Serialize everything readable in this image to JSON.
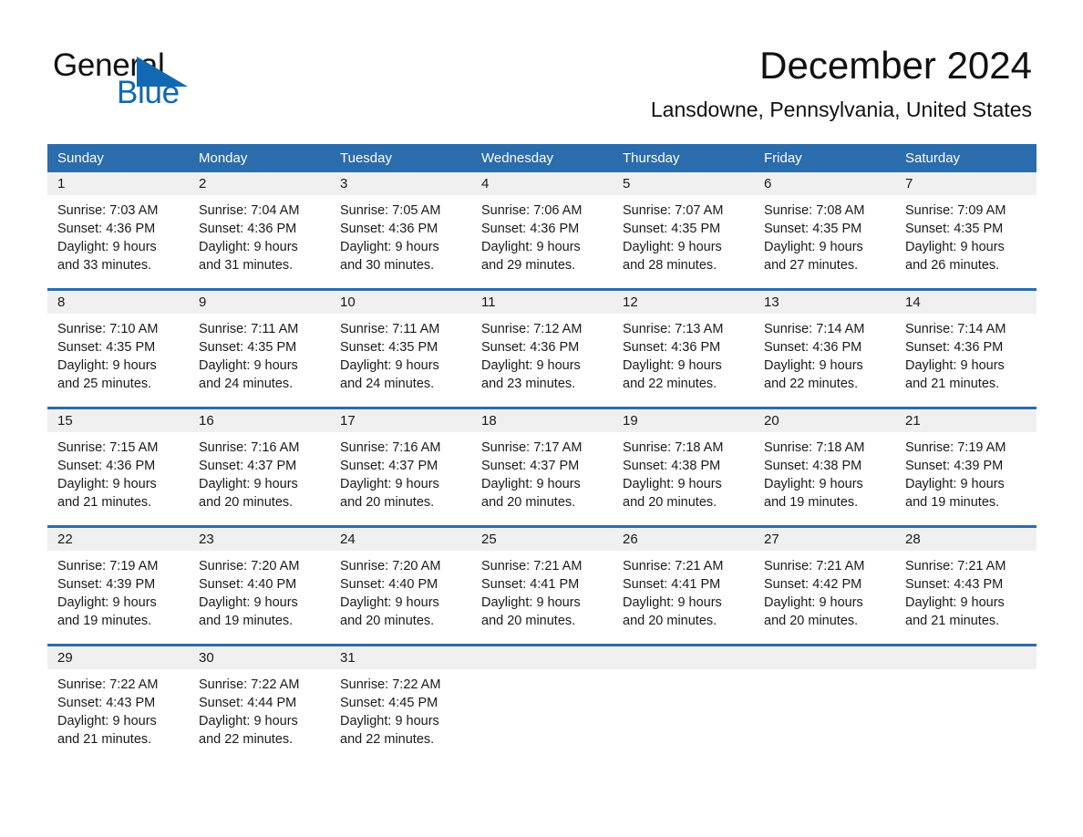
{
  "logo": {
    "word_one": "General",
    "word_two": "Blue",
    "triangle_icon": "blue-triangle-icon",
    "blue": "#1268b3"
  },
  "header": {
    "title": "December 2024",
    "location": "Lansdowne, Pennsylvania, United States"
  },
  "colors": {
    "header_blue": "#2b6cac",
    "row_divider_blue": "#2b6cac",
    "daynum_band": "#f0f0f0",
    "text": "#1a1a1a"
  },
  "weekdays": [
    "Sunday",
    "Monday",
    "Tuesday",
    "Wednesday",
    "Thursday",
    "Friday",
    "Saturday"
  ],
  "weeks": [
    [
      {
        "day": "1",
        "sunrise": "Sunrise: 7:03 AM",
        "sunset": "Sunset: 4:36 PM",
        "daylight_1": "Daylight: 9 hours",
        "daylight_2": "and 33 minutes."
      },
      {
        "day": "2",
        "sunrise": "Sunrise: 7:04 AM",
        "sunset": "Sunset: 4:36 PM",
        "daylight_1": "Daylight: 9 hours",
        "daylight_2": "and 31 minutes."
      },
      {
        "day": "3",
        "sunrise": "Sunrise: 7:05 AM",
        "sunset": "Sunset: 4:36 PM",
        "daylight_1": "Daylight: 9 hours",
        "daylight_2": "and 30 minutes."
      },
      {
        "day": "4",
        "sunrise": "Sunrise: 7:06 AM",
        "sunset": "Sunset: 4:36 PM",
        "daylight_1": "Daylight: 9 hours",
        "daylight_2": "and 29 minutes."
      },
      {
        "day": "5",
        "sunrise": "Sunrise: 7:07 AM",
        "sunset": "Sunset: 4:35 PM",
        "daylight_1": "Daylight: 9 hours",
        "daylight_2": "and 28 minutes."
      },
      {
        "day": "6",
        "sunrise": "Sunrise: 7:08 AM",
        "sunset": "Sunset: 4:35 PM",
        "daylight_1": "Daylight: 9 hours",
        "daylight_2": "and 27 minutes."
      },
      {
        "day": "7",
        "sunrise": "Sunrise: 7:09 AM",
        "sunset": "Sunset: 4:35 PM",
        "daylight_1": "Daylight: 9 hours",
        "daylight_2": "and 26 minutes."
      }
    ],
    [
      {
        "day": "8",
        "sunrise": "Sunrise: 7:10 AM",
        "sunset": "Sunset: 4:35 PM",
        "daylight_1": "Daylight: 9 hours",
        "daylight_2": "and 25 minutes."
      },
      {
        "day": "9",
        "sunrise": "Sunrise: 7:11 AM",
        "sunset": "Sunset: 4:35 PM",
        "daylight_1": "Daylight: 9 hours",
        "daylight_2": "and 24 minutes."
      },
      {
        "day": "10",
        "sunrise": "Sunrise: 7:11 AM",
        "sunset": "Sunset: 4:35 PM",
        "daylight_1": "Daylight: 9 hours",
        "daylight_2": "and 24 minutes."
      },
      {
        "day": "11",
        "sunrise": "Sunrise: 7:12 AM",
        "sunset": "Sunset: 4:36 PM",
        "daylight_1": "Daylight: 9 hours",
        "daylight_2": "and 23 minutes."
      },
      {
        "day": "12",
        "sunrise": "Sunrise: 7:13 AM",
        "sunset": "Sunset: 4:36 PM",
        "daylight_1": "Daylight: 9 hours",
        "daylight_2": "and 22 minutes."
      },
      {
        "day": "13",
        "sunrise": "Sunrise: 7:14 AM",
        "sunset": "Sunset: 4:36 PM",
        "daylight_1": "Daylight: 9 hours",
        "daylight_2": "and 22 minutes."
      },
      {
        "day": "14",
        "sunrise": "Sunrise: 7:14 AM",
        "sunset": "Sunset: 4:36 PM",
        "daylight_1": "Daylight: 9 hours",
        "daylight_2": "and 21 minutes."
      }
    ],
    [
      {
        "day": "15",
        "sunrise": "Sunrise: 7:15 AM",
        "sunset": "Sunset: 4:36 PM",
        "daylight_1": "Daylight: 9 hours",
        "daylight_2": "and 21 minutes."
      },
      {
        "day": "16",
        "sunrise": "Sunrise: 7:16 AM",
        "sunset": "Sunset: 4:37 PM",
        "daylight_1": "Daylight: 9 hours",
        "daylight_2": "and 20 minutes."
      },
      {
        "day": "17",
        "sunrise": "Sunrise: 7:16 AM",
        "sunset": "Sunset: 4:37 PM",
        "daylight_1": "Daylight: 9 hours",
        "daylight_2": "and 20 minutes."
      },
      {
        "day": "18",
        "sunrise": "Sunrise: 7:17 AM",
        "sunset": "Sunset: 4:37 PM",
        "daylight_1": "Daylight: 9 hours",
        "daylight_2": "and 20 minutes."
      },
      {
        "day": "19",
        "sunrise": "Sunrise: 7:18 AM",
        "sunset": "Sunset: 4:38 PM",
        "daylight_1": "Daylight: 9 hours",
        "daylight_2": "and 20 minutes."
      },
      {
        "day": "20",
        "sunrise": "Sunrise: 7:18 AM",
        "sunset": "Sunset: 4:38 PM",
        "daylight_1": "Daylight: 9 hours",
        "daylight_2": "and 19 minutes."
      },
      {
        "day": "21",
        "sunrise": "Sunrise: 7:19 AM",
        "sunset": "Sunset: 4:39 PM",
        "daylight_1": "Daylight: 9 hours",
        "daylight_2": "and 19 minutes."
      }
    ],
    [
      {
        "day": "22",
        "sunrise": "Sunrise: 7:19 AM",
        "sunset": "Sunset: 4:39 PM",
        "daylight_1": "Daylight: 9 hours",
        "daylight_2": "and 19 minutes."
      },
      {
        "day": "23",
        "sunrise": "Sunrise: 7:20 AM",
        "sunset": "Sunset: 4:40 PM",
        "daylight_1": "Daylight: 9 hours",
        "daylight_2": "and 19 minutes."
      },
      {
        "day": "24",
        "sunrise": "Sunrise: 7:20 AM",
        "sunset": "Sunset: 4:40 PM",
        "daylight_1": "Daylight: 9 hours",
        "daylight_2": "and 20 minutes."
      },
      {
        "day": "25",
        "sunrise": "Sunrise: 7:21 AM",
        "sunset": "Sunset: 4:41 PM",
        "daylight_1": "Daylight: 9 hours",
        "daylight_2": "and 20 minutes."
      },
      {
        "day": "26",
        "sunrise": "Sunrise: 7:21 AM",
        "sunset": "Sunset: 4:41 PM",
        "daylight_1": "Daylight: 9 hours",
        "daylight_2": "and 20 minutes."
      },
      {
        "day": "27",
        "sunrise": "Sunrise: 7:21 AM",
        "sunset": "Sunset: 4:42 PM",
        "daylight_1": "Daylight: 9 hours",
        "daylight_2": "and 20 minutes."
      },
      {
        "day": "28",
        "sunrise": "Sunrise: 7:21 AM",
        "sunset": "Sunset: 4:43 PM",
        "daylight_1": "Daylight: 9 hours",
        "daylight_2": "and 21 minutes."
      }
    ],
    [
      {
        "day": "29",
        "sunrise": "Sunrise: 7:22 AM",
        "sunset": "Sunset: 4:43 PM",
        "daylight_1": "Daylight: 9 hours",
        "daylight_2": "and 21 minutes."
      },
      {
        "day": "30",
        "sunrise": "Sunrise: 7:22 AM",
        "sunset": "Sunset: 4:44 PM",
        "daylight_1": "Daylight: 9 hours",
        "daylight_2": "and 22 minutes."
      },
      {
        "day": "31",
        "sunrise": "Sunrise: 7:22 AM",
        "sunset": "Sunset: 4:45 PM",
        "daylight_1": "Daylight: 9 hours",
        "daylight_2": "and 22 minutes."
      },
      {
        "day": "",
        "sunrise": "",
        "sunset": "",
        "daylight_1": "",
        "daylight_2": ""
      },
      {
        "day": "",
        "sunrise": "",
        "sunset": "",
        "daylight_1": "",
        "daylight_2": ""
      },
      {
        "day": "",
        "sunrise": "",
        "sunset": "",
        "daylight_1": "",
        "daylight_2": ""
      },
      {
        "day": "",
        "sunrise": "",
        "sunset": "",
        "daylight_1": "",
        "daylight_2": ""
      }
    ]
  ]
}
